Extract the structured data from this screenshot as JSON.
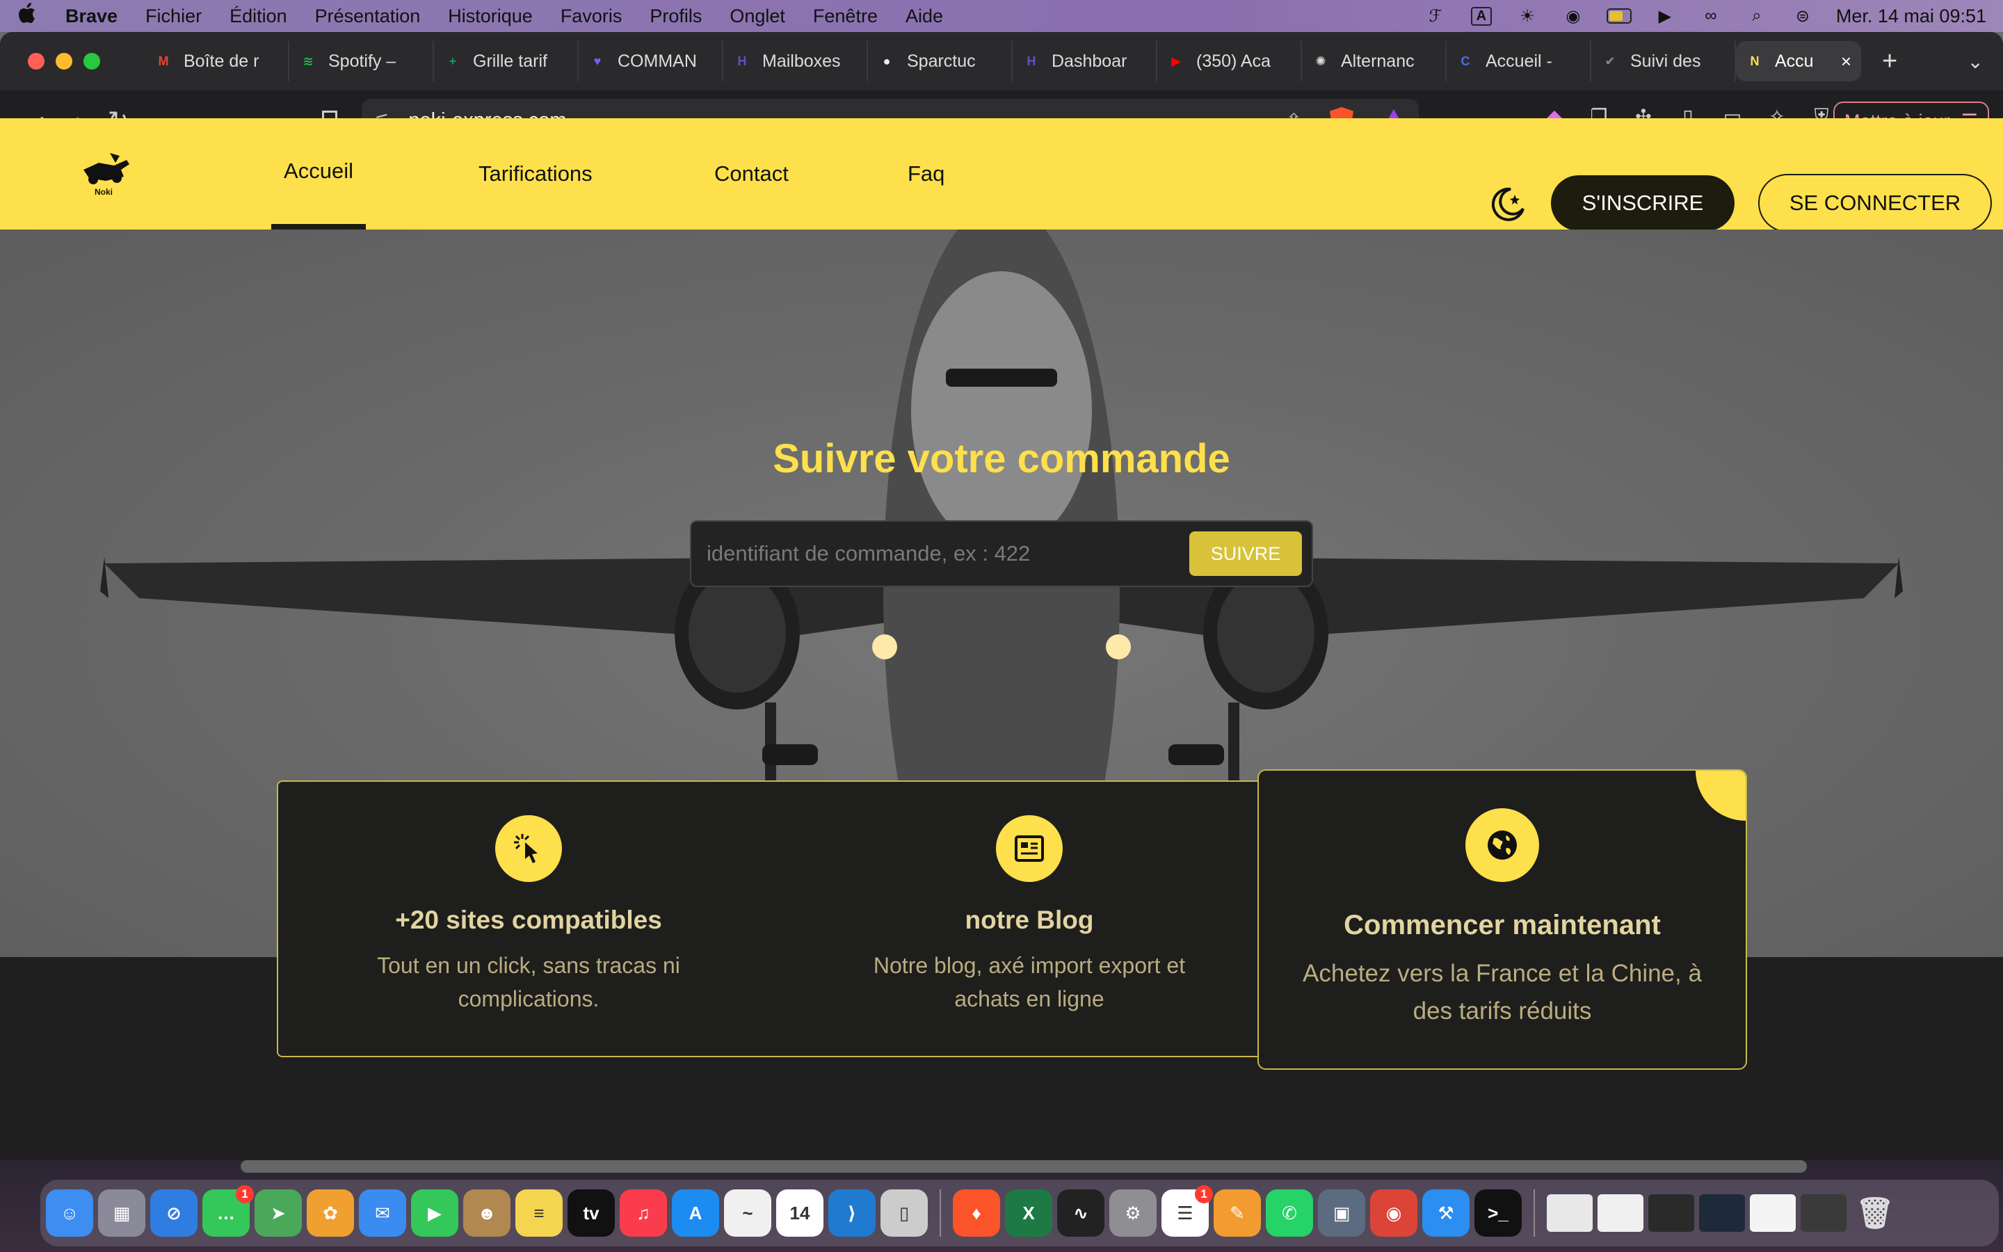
{
  "menubar": {
    "app_name": "Brave",
    "items": [
      "Fichier",
      "Édition",
      "Présentation",
      "Historique",
      "Favoris",
      "Profils",
      "Onglet",
      "Fenêtre",
      "Aide"
    ],
    "input_source": "A",
    "datetime": "Mer. 14 mai  09:51"
  },
  "tabs": [
    {
      "label": "Boîte de r",
      "icon": "gmail-icon",
      "color": "#ea4335",
      "glyph": "M"
    },
    {
      "label": "Spotify –",
      "icon": "spotify-icon",
      "color": "#1db954",
      "glyph": "≋"
    },
    {
      "label": "Grille tarif",
      "icon": "sheets-icon",
      "color": "#0f9d58",
      "glyph": "+"
    },
    {
      "label": "COMMAN",
      "icon": "heart-app-icon",
      "color": "#7b5cff",
      "glyph": "♥"
    },
    {
      "label": "Mailboxes",
      "icon": "mailboxes-icon",
      "color": "#6a4cc8",
      "glyph": "H"
    },
    {
      "label": "Sparctuc",
      "icon": "github-icon",
      "color": "#eeeeee",
      "glyph": "●"
    },
    {
      "label": "Dashboar",
      "icon": "dashboard-icon",
      "color": "#6a4cc8",
      "glyph": "H"
    },
    {
      "label": "(350) Aca",
      "icon": "youtube-icon",
      "color": "#ff0000",
      "glyph": "▶"
    },
    {
      "label": "Alternanc",
      "icon": "openai-icon",
      "color": "#dddddd",
      "glyph": "✺"
    },
    {
      "label": "Accueil -",
      "icon": "canva-icon",
      "color": "#4b6cf0",
      "glyph": "C"
    },
    {
      "label": "Suivi des",
      "icon": "check-icon",
      "color": "#888888",
      "glyph": "✔"
    },
    {
      "label": "Accu",
      "icon": "noki-tab-icon",
      "color": "#fde04b",
      "glyph": "N",
      "active": true
    }
  ],
  "browser": {
    "url": "noki-express.com",
    "update_button": "Mettre à jour"
  },
  "site": {
    "logo_text": "Noki",
    "nav": [
      "Accueil",
      "Tarifications",
      "Contact",
      "Faq"
    ],
    "active_nav": "Accueil",
    "signup": "S'INSCRIRE",
    "login": "SE CONNECTER",
    "accent": "#fde04b",
    "hero": {
      "title": "Suivre votre commande",
      "placeholder": "identifiant de commande, ex : 422",
      "button": "SUIVRE"
    },
    "cards": [
      {
        "title": "+20 sites compatibles",
        "text": "Tout en un click, sans tracas ni complications.",
        "icon": "click-pointer-icon"
      },
      {
        "title": "notre Blog",
        "text": "Notre blog, axé import export et achats en ligne",
        "icon": "newspaper-icon"
      },
      {
        "title": "Commencer maintenant",
        "text": "Achetez vers la France et la Chine, à des tarifs réduits",
        "icon": "globe-icon"
      }
    ]
  },
  "dock": {
    "apps": [
      {
        "name": "finder",
        "color": "#3d8ef0",
        "glyph": "☺"
      },
      {
        "name": "launchpad",
        "color": "#8a8a9a",
        "glyph": "▦"
      },
      {
        "name": "safari",
        "color": "#2f7de1",
        "glyph": "⊘"
      },
      {
        "name": "messages",
        "color": "#34c759",
        "glyph": "…",
        "badge": "1"
      },
      {
        "name": "maps",
        "color": "#4aa85a",
        "glyph": "➤"
      },
      {
        "name": "photos",
        "color": "#f0a030",
        "glyph": "✿"
      },
      {
        "name": "mail",
        "color": "#3b8cf0",
        "glyph": "✉"
      },
      {
        "name": "facetime",
        "color": "#34c759",
        "glyph": "▶"
      },
      {
        "name": "contacts",
        "color": "#b08850",
        "glyph": "☻"
      },
      {
        "name": "notes",
        "color": "#f5d550",
        "glyph": "≡"
      },
      {
        "name": "tv",
        "color": "#111111",
        "glyph": "tv"
      },
      {
        "name": "music",
        "color": "#fa3c4c",
        "glyph": "♫"
      },
      {
        "name": "app-store",
        "color": "#1c8cf0",
        "glyph": "A"
      },
      {
        "name": "freeform",
        "color": "#f0f0f0",
        "glyph": "~"
      },
      {
        "name": "calendar",
        "color": "#ffffff",
        "glyph": "14"
      },
      {
        "name": "vscode",
        "color": "#1f7ad0",
        "glyph": "⟩"
      },
      {
        "name": "iphone-mirroring",
        "color": "#cccccc",
        "glyph": "▯"
      },
      {
        "name": "brave",
        "color": "#fb542b",
        "glyph": "♦"
      },
      {
        "name": "excel",
        "color": "#1d7a45",
        "glyph": "X"
      },
      {
        "name": "activity-monitor",
        "color": "#222222",
        "glyph": "∿"
      },
      {
        "name": "system-settings",
        "color": "#8e8e93",
        "glyph": "⚙"
      },
      {
        "name": "reminders",
        "color": "#ffffff",
        "glyph": "☰",
        "badge": "1"
      },
      {
        "name": "pages",
        "color": "#f29b30",
        "glyph": "✎"
      },
      {
        "name": "whatsapp",
        "color": "#25d366",
        "glyph": "✆"
      },
      {
        "name": "preview",
        "color": "#5c6b80",
        "glyph": "▣"
      },
      {
        "name": "chrome",
        "color": "#db4437",
        "glyph": "◉"
      },
      {
        "name": "xcode",
        "color": "#2b8ef0",
        "glyph": "⚒"
      },
      {
        "name": "terminal",
        "color": "#111111",
        "glyph": ">_"
      }
    ]
  }
}
